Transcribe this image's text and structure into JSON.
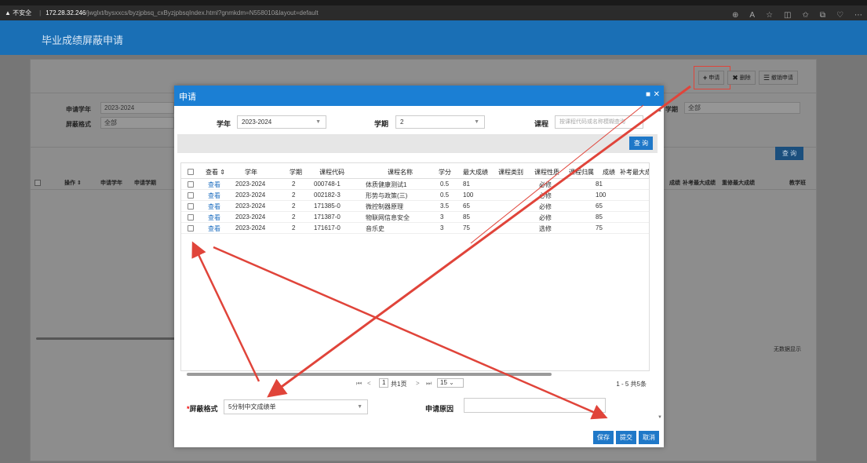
{
  "browser": {
    "warning": "▲ 不安全",
    "url_host": "172.28.32.246",
    "url_rest": "/jwglxt/bysxxcs/byzjpbsq_cxByzjpbsqIndex.html?gnmkdm=N558010&layout=default"
  },
  "app": {
    "title": "毕业成绩屏蔽申请"
  },
  "toolbar": {
    "apply": "申请",
    "delete": "删除",
    "revoke": "撤销申请"
  },
  "bg_filters": {
    "year_label": "申请学年",
    "year_value": "2023-2024",
    "format_label": "屏蔽格式",
    "format_value": "全部",
    "term_label": "学期",
    "term_value": "全部",
    "query": "查 询"
  },
  "bg_table": {
    "headers": [
      "操作 ⇕",
      "申请学年",
      "申请学期"
    ],
    "right_headers": [
      "成绩",
      "补考最大成绩",
      "重修最大成绩",
      "教学班"
    ],
    "nodata": "无数据显示"
  },
  "modal": {
    "title": "申请",
    "filters": {
      "year_label": "学年",
      "year_value": "2023-2024",
      "term_label": "学期",
      "term_value": "2",
      "course_label": "课程",
      "course_placeholder": "按课程代码或名称模糊查询"
    },
    "search_btn": "查 询",
    "columns": [
      "查看 ⇕",
      "学年",
      "学期",
      "课程代码",
      "课程名称",
      "学分",
      "最大成绩",
      "课程类别",
      "课程性质",
      "课程归属",
      "成绩",
      "补考最大成"
    ],
    "rows": [
      {
        "view": "查看",
        "year": "2023-2024",
        "term": "2",
        "code": "000748-1",
        "name": "体质健康测试1",
        "credit": "0.5",
        "max": "81",
        "nature": "必修",
        "score": "81"
      },
      {
        "view": "查看",
        "year": "2023-2024",
        "term": "2",
        "code": "002182-3",
        "name": "形势与政策(三)",
        "credit": "0.5",
        "max": "100",
        "nature": "必修",
        "score": "100"
      },
      {
        "view": "查看",
        "year": "2023-2024",
        "term": "2",
        "code": "171385-0",
        "name": "微控制器原理",
        "credit": "3.5",
        "max": "65",
        "nature": "必修",
        "score": "65"
      },
      {
        "view": "查看",
        "year": "2023-2024",
        "term": "2",
        "code": "171387-0",
        "name": "物联网信息安全",
        "credit": "3",
        "max": "85",
        "nature": "必修",
        "score": "85"
      },
      {
        "view": "查看",
        "year": "2023-2024",
        "term": "2",
        "code": "171617-0",
        "name": "音乐史",
        "credit": "3",
        "max": "75",
        "nature": "选修",
        "score": "75"
      }
    ],
    "pager": {
      "first": "⏮",
      "prev": "<",
      "page": "1",
      "total_pages": "共1页",
      "next": ">",
      "last": "⏭",
      "size": "15",
      "info": "1 - 5  共5条"
    },
    "format_label": "屏蔽格式",
    "format_value": "5分制中文成绩单",
    "reason_label": "申请原因",
    "reason_value": "",
    "buttons": {
      "save": "保存",
      "submit": "提交",
      "cancel": "取消"
    }
  },
  "colors": {
    "header_blue": "#1a6fb5",
    "modal_blue": "#1b7fd4",
    "annotation_red": "#e0443a"
  }
}
